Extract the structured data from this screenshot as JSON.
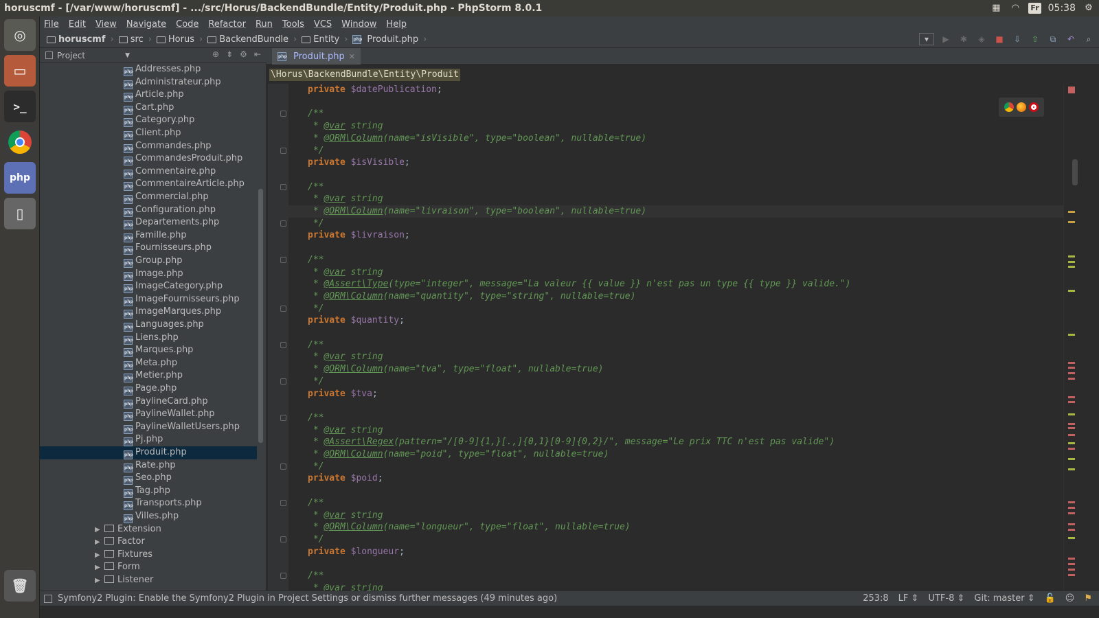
{
  "titlebar": {
    "title": "horuscmf - [/var/www/horuscmf] - .../src/Horus/BackendBundle/Entity/Produit.php - PhpStorm 8.0.1",
    "keyboard": "Fr",
    "clock": "05:38"
  },
  "menu": [
    "File",
    "Edit",
    "View",
    "Navigate",
    "Code",
    "Refactor",
    "Run",
    "Tools",
    "VCS",
    "Window",
    "Help"
  ],
  "breadcrumb": [
    "horuscmf",
    "src",
    "Horus",
    "BackendBundle",
    "Entity",
    "Produit.php"
  ],
  "project_panel": {
    "title": "Project"
  },
  "tree": {
    "files": [
      "Addresses.php",
      "Administrateur.php",
      "Article.php",
      "Cart.php",
      "Category.php",
      "Client.php",
      "Commandes.php",
      "CommandesProduit.php",
      "Commentaire.php",
      "CommentaireArticle.php",
      "Commercial.php",
      "Configuration.php",
      "Departements.php",
      "Famille.php",
      "Fournisseurs.php",
      "Group.php",
      "Image.php",
      "ImageCategory.php",
      "ImageFournisseurs.php",
      "ImageMarques.php",
      "Languages.php",
      "Liens.php",
      "Marques.php",
      "Meta.php",
      "Metier.php",
      "Page.php",
      "PaylineCard.php",
      "PaylineWallet.php",
      "PaylineWalletUsers.php",
      "Pj.php",
      "Produit.php",
      "Rate.php",
      "Seo.php",
      "Tag.php",
      "Transports.php",
      "Villes.php"
    ],
    "selected": "Produit.php",
    "folders": [
      "Extension",
      "Factor",
      "Fixtures",
      "Form",
      "Listener"
    ]
  },
  "editor": {
    "tab": "Produit.php",
    "namespace_path": "\\Horus\\BackendBundle\\Entity\\Produit",
    "lines": [
      {
        "t": "code",
        "kw": "private ",
        "var": "$datePublication",
        "rest": ";"
      },
      {
        "t": "blank"
      },
      {
        "t": "cm",
        "text": "/**"
      },
      {
        "t": "cm",
        "text": " * @var string"
      },
      {
        "t": "cm",
        "text": " * @ORM\\Column(name=\"isVisible\", type=\"boolean\", nullable=true)"
      },
      {
        "t": "cm",
        "text": " */"
      },
      {
        "t": "code",
        "kw": "private ",
        "var": "$isVisible",
        "rest": ";"
      },
      {
        "t": "blank"
      },
      {
        "t": "cm",
        "text": "/**"
      },
      {
        "t": "cm",
        "text": " * @var string"
      },
      {
        "t": "cm",
        "text": " * @ORM\\Column(name=\"livraison\", type=\"boolean\", nullable=true)",
        "cur": true
      },
      {
        "t": "cm",
        "text": " */"
      },
      {
        "t": "code",
        "kw": "private ",
        "var": "$livraison",
        "rest": ";"
      },
      {
        "t": "blank"
      },
      {
        "t": "cm",
        "text": "/**"
      },
      {
        "t": "cm",
        "text": " * @var string"
      },
      {
        "t": "cm",
        "text": " * @Assert\\Type(type=\"integer\", message=\"La valeur {{ value }} n'est pas un type {{ type }} valide.\")"
      },
      {
        "t": "cm",
        "text": " * @ORM\\Column(name=\"quantity\", type=\"string\", nullable=true)"
      },
      {
        "t": "cm",
        "text": " */"
      },
      {
        "t": "code",
        "kw": "private ",
        "var": "$quantity",
        "rest": ";"
      },
      {
        "t": "blank"
      },
      {
        "t": "cm",
        "text": "/**"
      },
      {
        "t": "cm",
        "text": " * @var string"
      },
      {
        "t": "cm",
        "text": " * @ORM\\Column(name=\"tva\", type=\"float\", nullable=true)"
      },
      {
        "t": "cm",
        "text": " */"
      },
      {
        "t": "code",
        "kw": "private ",
        "var": "$tva",
        "rest": ";"
      },
      {
        "t": "blank"
      },
      {
        "t": "cm",
        "text": "/**"
      },
      {
        "t": "cm",
        "text": " * @var string"
      },
      {
        "t": "cm",
        "text": " * @Assert\\Regex(pattern=\"/[0-9]{1,}[.,]{0,1}[0-9]{0,2}/\", message=\"Le prix TTC n'est pas valide\")"
      },
      {
        "t": "cm",
        "text": " * @ORM\\Column(name=\"poid\", type=\"float\", nullable=true)"
      },
      {
        "t": "cm",
        "text": " */"
      },
      {
        "t": "code",
        "kw": "private ",
        "var": "$poid",
        "rest": ";"
      },
      {
        "t": "blank"
      },
      {
        "t": "cm",
        "text": "/**"
      },
      {
        "t": "cm",
        "text": " * @var string"
      },
      {
        "t": "cm",
        "text": " * @ORM\\Column(name=\"longueur\", type=\"float\", nullable=true)"
      },
      {
        "t": "cm",
        "text": " */"
      },
      {
        "t": "code",
        "kw": "private ",
        "var": "$longueur",
        "rest": ";"
      },
      {
        "t": "blank"
      },
      {
        "t": "cm",
        "text": "/**"
      },
      {
        "t": "cm",
        "text": " * @var string"
      }
    ]
  },
  "status": {
    "message": "Symfony2 Plugin: Enable the Symfony2 Plugin in Project Settings or dismiss further messages (49 minutes ago)",
    "position": "253:8",
    "line_sep": "LF",
    "encoding": "UTF-8",
    "vcs": "Git: master"
  },
  "colors": {
    "keyword": "#cc7832",
    "variable": "#9876aa",
    "comment": "#629755",
    "selection": "#0d293e"
  }
}
